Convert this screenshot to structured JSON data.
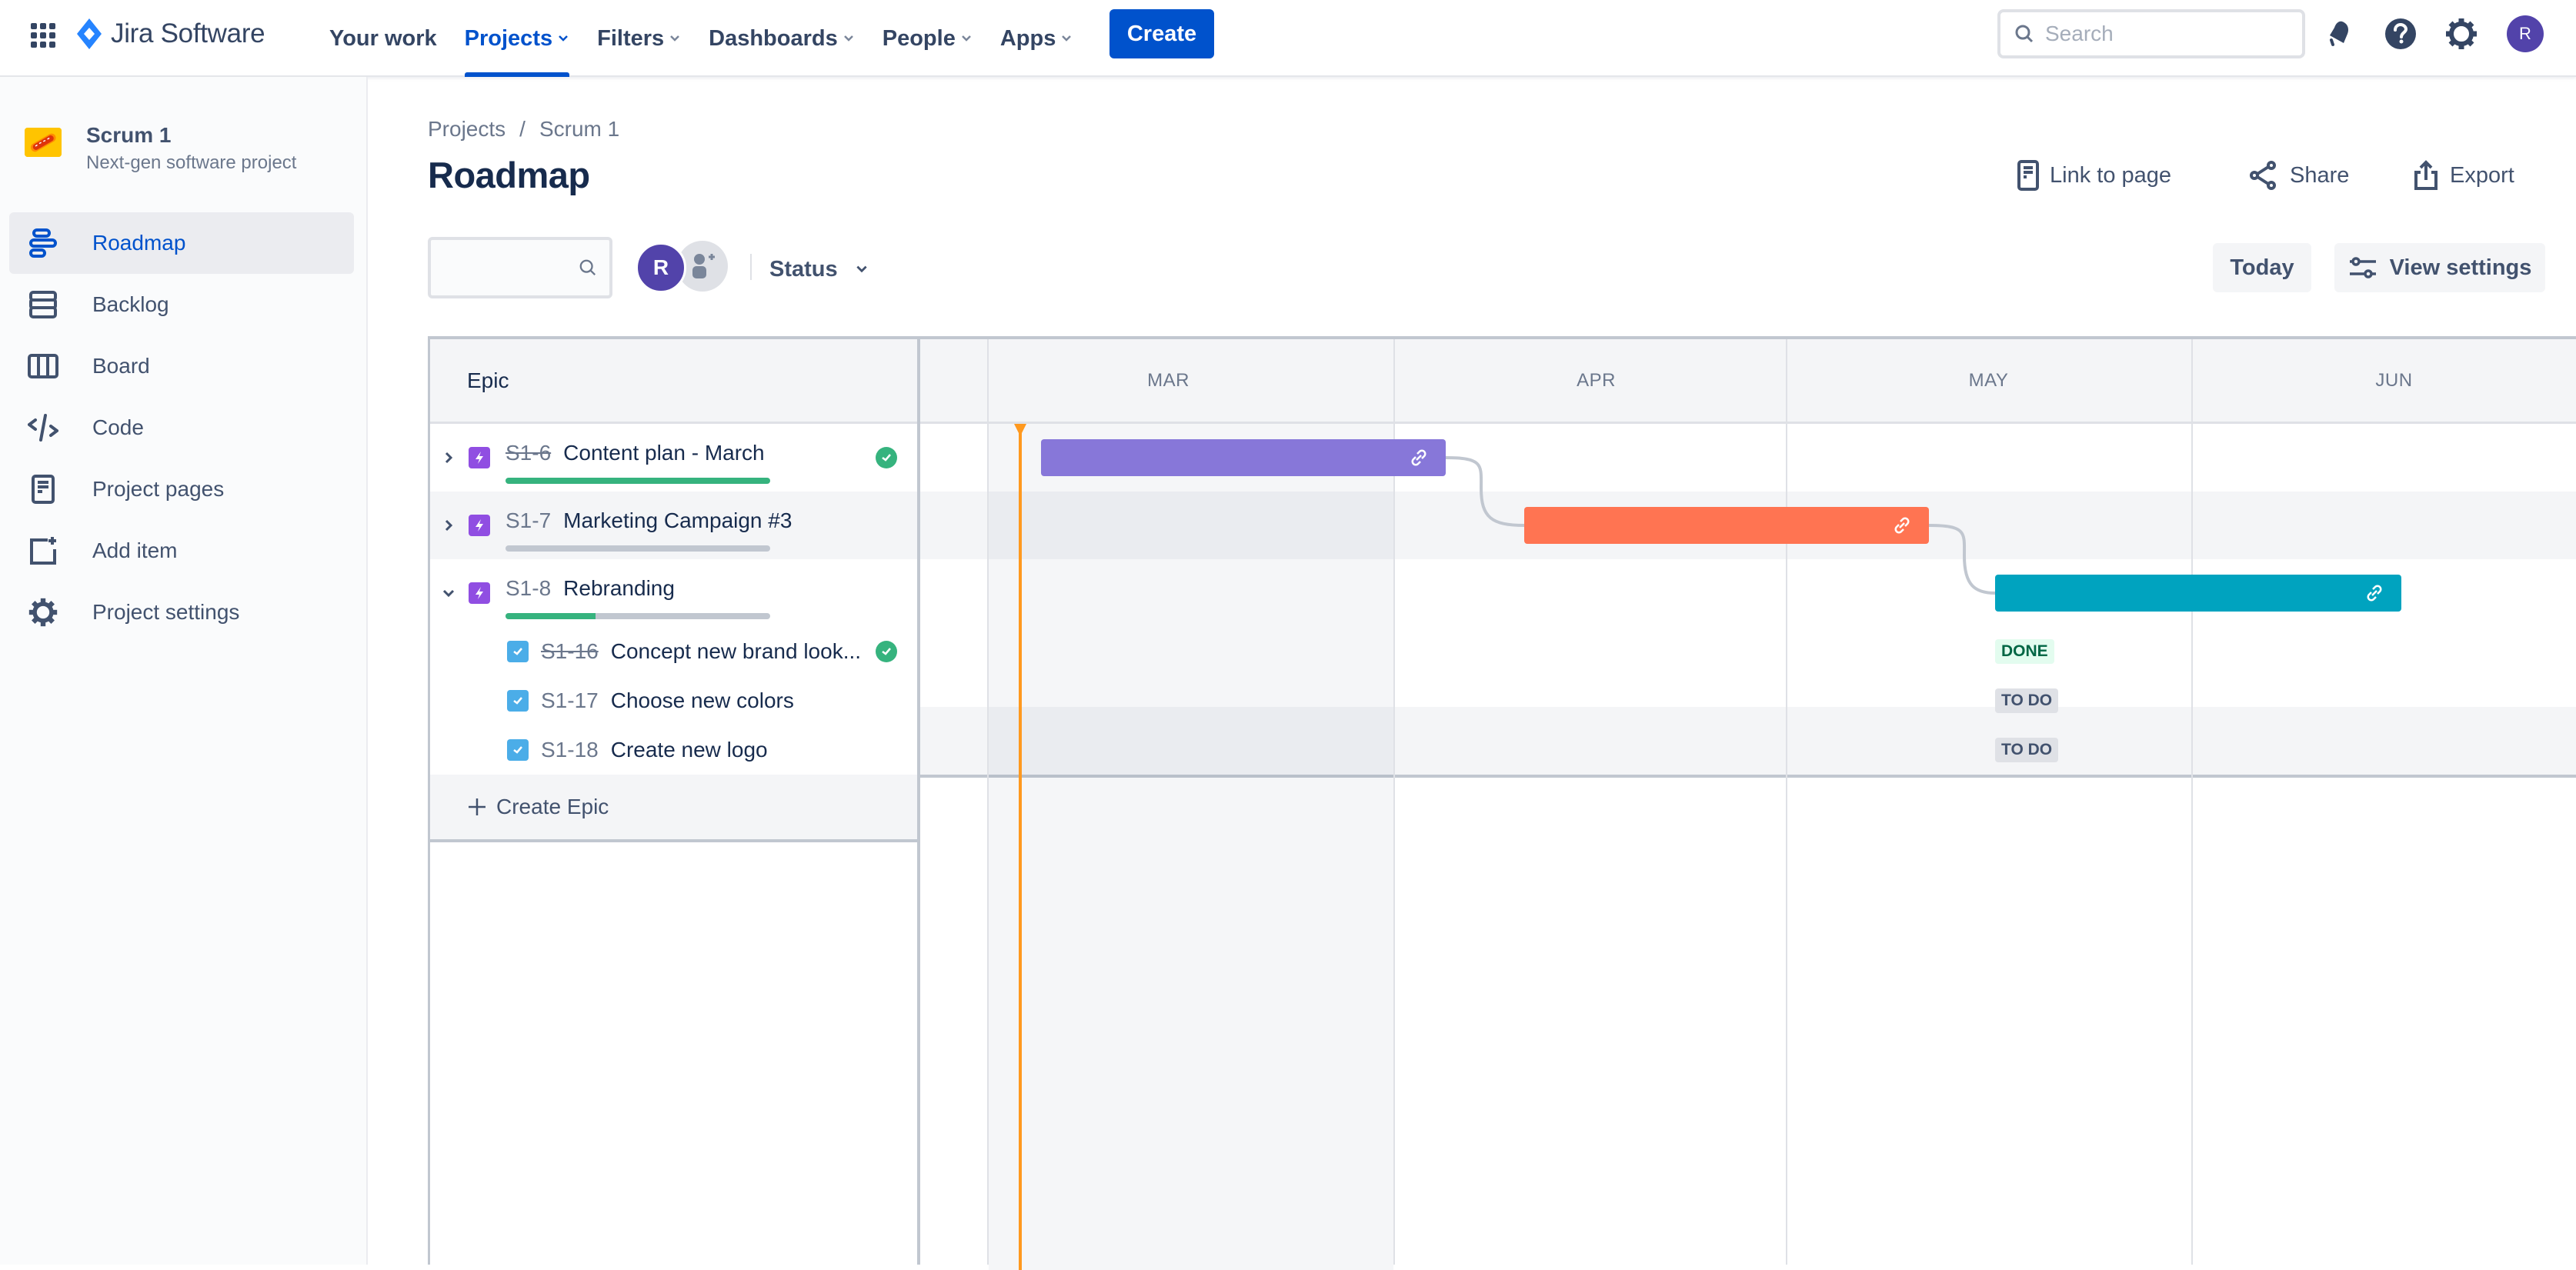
{
  "topnav": {
    "product_name": "Jira Software",
    "items": [
      {
        "label": "Your work",
        "has_dropdown": false,
        "active": false
      },
      {
        "label": "Projects",
        "has_dropdown": true,
        "active": true
      },
      {
        "label": "Filters",
        "has_dropdown": true,
        "active": false
      },
      {
        "label": "Dashboards",
        "has_dropdown": true,
        "active": false
      },
      {
        "label": "People",
        "has_dropdown": true,
        "active": false
      },
      {
        "label": "Apps",
        "has_dropdown": true,
        "active": false
      }
    ],
    "create_label": "Create",
    "search_placeholder": "Search",
    "user_initial": "R",
    "icons": [
      "notifications-icon",
      "help-icon",
      "settings-icon"
    ]
  },
  "sidebar": {
    "project_name": "Scrum 1",
    "project_type": "Next-gen software project",
    "items": [
      {
        "label": "Roadmap",
        "icon": "roadmap-icon",
        "active": true
      },
      {
        "label": "Backlog",
        "icon": "backlog-icon",
        "active": false
      },
      {
        "label": "Board",
        "icon": "board-icon",
        "active": false
      },
      {
        "label": "Code",
        "icon": "code-icon",
        "active": false
      },
      {
        "label": "Project pages",
        "icon": "project-pages-icon",
        "active": false
      },
      {
        "label": "Add item",
        "icon": "add-item-icon",
        "active": false
      },
      {
        "label": "Project settings",
        "icon": "gear-icon",
        "active": false
      }
    ]
  },
  "breadcrumb": [
    "Projects",
    "Scrum 1"
  ],
  "page_title": "Roadmap",
  "header_actions": {
    "link_to_page": "Link to page",
    "share": "Share",
    "export": "Export"
  },
  "toolbar": {
    "search_value": "",
    "assignee_initial": "R",
    "status_label": "Status",
    "today_label": "Today",
    "view_settings_label": "View settings"
  },
  "roadmap": {
    "epic_column_header": "Epic",
    "months": [
      "MAR",
      "APR",
      "MAY",
      "JUN"
    ],
    "today_month_fraction": "early MAR",
    "epics": [
      {
        "key": "S1-6",
        "title": "Content plan - March",
        "done": true,
        "expanded": false,
        "progress_done_pct": 100,
        "bar_color": "#8777d9",
        "start": "MAR 4",
        "end": "APR 2",
        "children": []
      },
      {
        "key": "S1-7",
        "title": "Marketing Campaign #3",
        "done": false,
        "expanded": false,
        "progress_done_pct": 0,
        "bar_color": "#ff7452",
        "start": "APR 4",
        "end": "MAY 4",
        "children": []
      },
      {
        "key": "S1-8",
        "title": "Rebranding",
        "done": false,
        "expanded": true,
        "progress_done_pct": 34,
        "bar_color": "#00a3bf",
        "start": "MAY 1",
        "end": "JUN 1",
        "children": [
          {
            "key": "S1-16",
            "title": "Concept new brand look...",
            "done": true,
            "status": "DONE"
          },
          {
            "key": "S1-17",
            "title": "Choose new colors",
            "done": false,
            "status": "TO DO"
          },
          {
            "key": "S1-18",
            "title": "Create new logo",
            "done": false,
            "status": "TO DO"
          }
        ]
      }
    ],
    "create_epic_label": "Create Epic",
    "status_colors": {
      "DONE": {
        "bg": "#e3fcef",
        "fg": "#006644"
      },
      "TO DO": {
        "bg": "#dfe1e6",
        "fg": "#42526e"
      }
    }
  }
}
